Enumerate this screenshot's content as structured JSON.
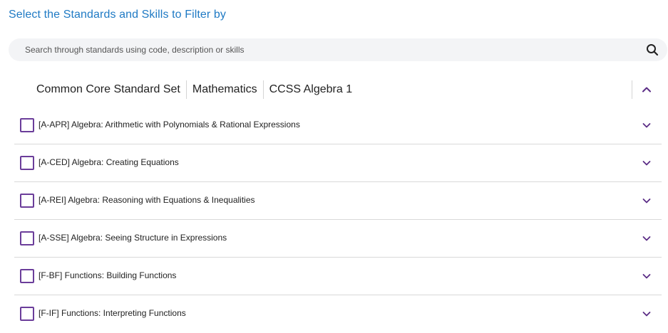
{
  "header": {
    "title": "Select the Standards and Skills to Filter by"
  },
  "search": {
    "placeholder": "Search through standards using code, description or skills",
    "value": ""
  },
  "breadcrumb": {
    "items": [
      "Common Core Standard Set",
      "Mathematics",
      "CCSS Algebra 1"
    ]
  },
  "standards": [
    {
      "label": "[A-APR] Algebra: Arithmetic with Polynomials & Rational Expressions",
      "checked": false
    },
    {
      "label": "[A-CED] Algebra: Creating Equations",
      "checked": false
    },
    {
      "label": "[A-REI] Algebra: Reasoning with Equations & Inequalities",
      "checked": false
    },
    {
      "label": "[A-SSE] Algebra: Seeing Structure in Expressions",
      "checked": false
    },
    {
      "label": "[F-BF] Functions: Building Functions",
      "checked": false
    },
    {
      "label": "[F-IF] Functions: Interpreting Functions",
      "checked": false
    }
  ],
  "icons": {
    "search": "search-icon",
    "collapse": "chevron-up-icon",
    "expand": "chevron-down-icon"
  },
  "colors": {
    "heading": "#1f7ac4",
    "accent": "#6b3d9a",
    "search_bg": "#f3f4f6",
    "divider": "#d9d9d9"
  }
}
